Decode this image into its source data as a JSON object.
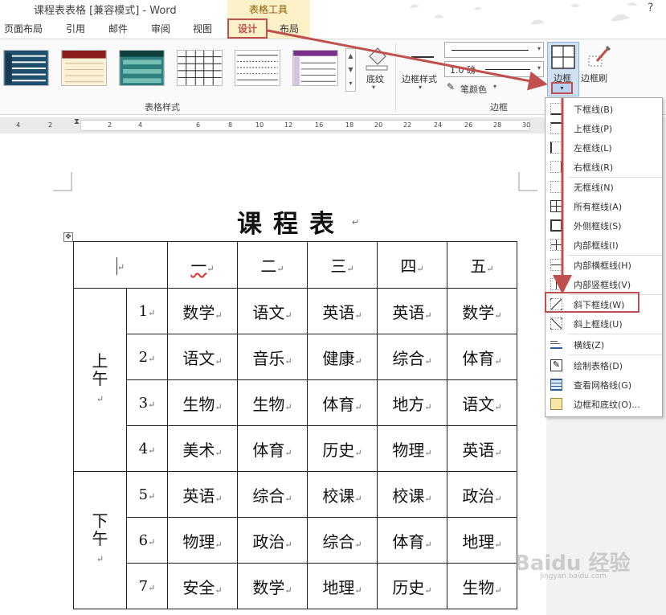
{
  "window": {
    "title": "课程表表格 [兼容模式] - Word",
    "contextual_tools_label": "表格工具",
    "help_icon": "?"
  },
  "tabs": [
    "页面布局",
    "引用",
    "邮件",
    "审阅",
    "视图",
    "设计",
    "布局"
  ],
  "ribbon": {
    "shading_label": "底纹",
    "border_styles_label": "边框样式",
    "line_weight": "1.0 磅",
    "pen_color_label": "笔颜色",
    "borders_label": "边框",
    "border_painter_label": "边框刷",
    "group_table_styles": "表格样式",
    "group_borders": "边框"
  },
  "ruler": [
    "4",
    "2",
    "2",
    "4",
    "6",
    "8",
    "10",
    "12",
    "14",
    "16",
    "18",
    "20",
    "22",
    "24",
    "26",
    "28",
    "30"
  ],
  "document": {
    "heading": "课程表",
    "header_row": [
      "",
      "一",
      "二",
      "三",
      "四",
      "五"
    ],
    "morning_label": "上午",
    "afternoon_label": "下午",
    "rows": [
      {
        "num": "1",
        "subjects": [
          "数学",
          "语文",
          "英语",
          "英语",
          "数学"
        ]
      },
      {
        "num": "2",
        "subjects": [
          "语文",
          "音乐",
          "健康",
          "综合",
          "体育"
        ]
      },
      {
        "num": "3",
        "subjects": [
          "生物",
          "生物",
          "体育",
          "地方",
          "语文"
        ]
      },
      {
        "num": "4",
        "subjects": [
          "美术",
          "体育",
          "历史",
          "物理",
          "英语"
        ]
      },
      {
        "num": "5",
        "subjects": [
          "英语",
          "综合",
          "校课",
          "校课",
          "政治"
        ]
      },
      {
        "num": "6",
        "subjects": [
          "物理",
          "政治",
          "综合",
          "体育",
          "地理"
        ]
      },
      {
        "num": "7",
        "subjects": [
          "安全",
          "数学",
          "地理",
          "历史",
          "生物"
        ]
      }
    ]
  },
  "menu": {
    "items": [
      {
        "label": "下框线(B)",
        "icon": "bottom-border-icon"
      },
      {
        "label": "上框线(P)",
        "icon": "top-border-icon"
      },
      {
        "label": "左框线(L)",
        "icon": "left-border-icon"
      },
      {
        "label": "右框线(R)",
        "icon": "right-border-icon"
      },
      {
        "label": "无框线(N)",
        "icon": "no-border-icon"
      },
      {
        "label": "所有框线(A)",
        "icon": "all-borders-icon"
      },
      {
        "label": "外侧框线(S)",
        "icon": "outside-borders-icon"
      },
      {
        "label": "内部框线(I)",
        "icon": "inside-borders-icon"
      },
      {
        "label": "内部横框线(H)",
        "icon": "inside-horizontal-border-icon"
      },
      {
        "label": "内部竖框线(V)",
        "icon": "inside-vertical-border-icon"
      },
      {
        "label": "斜下框线(W)",
        "icon": "diagonal-down-border-icon"
      },
      {
        "label": "斜上框线(U)",
        "icon": "diagonal-up-border-icon"
      },
      {
        "label": "横线(Z)",
        "icon": "horizontal-line-icon"
      },
      {
        "label": "绘制表格(D)",
        "icon": "draw-table-icon"
      },
      {
        "label": "查看网格线(G)",
        "icon": "view-gridlines-icon"
      },
      {
        "label": "边框和底纹(O)...",
        "icon": "borders-shading-icon"
      }
    ]
  },
  "watermark": {
    "main": "Baidu 经验",
    "sub": "jingyan.baidu.com"
  },
  "colors": {
    "highlight": "#c0504d",
    "tools_bg": "#fdf1c7",
    "selected_tab": "#c0504d"
  }
}
